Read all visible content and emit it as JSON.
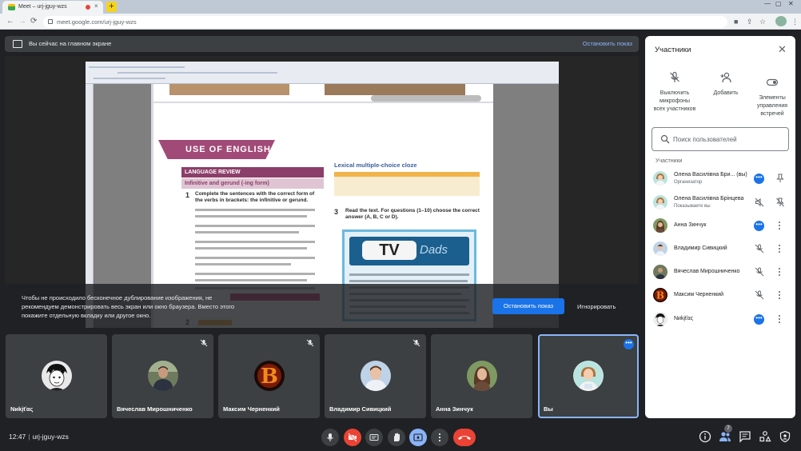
{
  "browser": {
    "tab_title": "Meet – urj-jguy-wzs",
    "tab_close": "×",
    "new_tab": "+",
    "url": "meet.google.com/urj-jguy-wzs"
  },
  "banner": {
    "text": "Вы сейчас на главном экране",
    "stop_label": "Остановить показ"
  },
  "shared_screen": {
    "use_of_english": "USE OF ENGLISH",
    "language_review": "LANGUAGE REVIEW",
    "infinitive_gerund": "Infinitive and gerund (-ing form)",
    "num1": "1",
    "ex1": "Complete the sentences with the correct form of the verbs in brackets: the infinitive or gerund.",
    "lexical_heading": "Lexical multiple-choice cloze",
    "num3": "3",
    "ex3": "Read the text. For questions (1–10) choose the correct answer (A, B, C or D).",
    "tv": "TV",
    "dads": "Dads",
    "num2": "2"
  },
  "warning": {
    "text": "Чтобы не происходило бесконечное дублирование изображения, не рекомендуем демонстрировать весь экран или окно браузера. Вместо этого покажите отдельную вкладку или другое окно.",
    "stop_button": "Остановить показ",
    "ignore_button": "Игнорировать"
  },
  "tiles": [
    {
      "name": "Nиkįťας",
      "muted": false
    },
    {
      "name": "Вячеслав Мирошниченко",
      "muted": true
    },
    {
      "name": "Максим Черненкий",
      "muted": true
    },
    {
      "name": "Владимир Сивицкий",
      "muted": true
    },
    {
      "name": "Анна Зинчук",
      "muted": false
    },
    {
      "name": "Вы",
      "muted": false
    }
  ],
  "bottom": {
    "time": "12:47",
    "meeting_code": "urj-jguy-wzs",
    "participants_count": "7"
  },
  "panel": {
    "title": "Участники",
    "mute_all": "Выключить микрофоны всех участников",
    "add": "Добавить",
    "host_controls": "Элементы управления встречей",
    "search_placeholder": "Поиск пользователей",
    "section_label": "Участники",
    "participants": [
      {
        "name": "Олена Василівна Бри... (вы)",
        "sub": "Организатор"
      },
      {
        "name": "Олена Василівна Брiнцева",
        "sub": "Показываете вы"
      },
      {
        "name": "Анна Зинчук",
        "sub": ""
      },
      {
        "name": "Владимир Сивицкий",
        "sub": ""
      },
      {
        "name": "Вячеслав Мирошниченко",
        "sub": ""
      },
      {
        "name": "Максим Черненкий",
        "sub": ""
      },
      {
        "name": "Nиkįťας",
        "sub": ""
      }
    ]
  },
  "colors": {
    "accent": "#1a73e8",
    "accent_light": "#8ab4f8",
    "danger": "#ea4335",
    "tile_bg": "#3c4043",
    "page_bg": "#202124"
  }
}
